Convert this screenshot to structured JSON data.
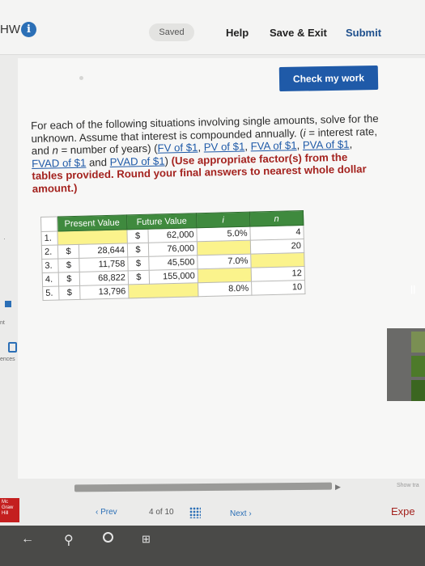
{
  "header": {
    "hw_label": "HW",
    "info_glyph": "i",
    "saved": "Saved",
    "help": "Help",
    "save_exit": "Save & Exit",
    "submit": "Submit"
  },
  "check_button": "Check my work",
  "question": {
    "intro": "For each of the following situations involving single amounts, solve for the unknown. Assume that interest is compounded annually. (",
    "i_var": "i",
    "i_def": " = interest rate, and ",
    "n_var": "n",
    "n_def": " = number of years) (",
    "links": [
      "FV of $1",
      "PV of $1",
      "FVA of $1",
      "PVA of $1",
      "FVAD of $1",
      "PVAD of $1"
    ],
    "sep_comma": ", ",
    "sep_and": " and ",
    "close": ")",
    "instruction": " (Use appropriate factor(s) from the tables provided. Round your final answers to nearest whole dollar amount.)"
  },
  "table": {
    "headers": [
      "Present Value",
      "Future Value",
      "i",
      "n"
    ],
    "rows": [
      {
        "num": "1.",
        "pv_sign": "",
        "pv": "",
        "fv_sign": "$",
        "fv": "62,000",
        "i": "5.0%",
        "n": "4"
      },
      {
        "num": "2.",
        "pv_sign": "$",
        "pv": "28,644",
        "fv_sign": "$",
        "fv": "76,000",
        "i": "",
        "n": "20"
      },
      {
        "num": "3.",
        "pv_sign": "$",
        "pv": "11,758",
        "fv_sign": "$",
        "fv": "45,500",
        "i": "7.0%",
        "n": ""
      },
      {
        "num": "4.",
        "pv_sign": "$",
        "pv": "68,822",
        "fv_sign": "$",
        "fv": "155,000",
        "i": "",
        "n": "12"
      },
      {
        "num": "5.",
        "pv_sign": "$",
        "pv": "13,796",
        "fv_sign": "",
        "fv": "",
        "i": "8.0%",
        "n": "10"
      }
    ]
  },
  "pager": {
    "prev": "‹ Prev",
    "count": "4 of 10",
    "next": "Next ›"
  },
  "left_sidebar": {
    "nt": "nt",
    "references": "ences",
    "logo_text": "Mc Graw Hill"
  },
  "right_edge": {
    "show_tra": "Show tra",
    "expe": "Expe",
    "bars": "||"
  },
  "taskbar": {
    "back": "←",
    "search": "⚲",
    "task": "⊞"
  }
}
